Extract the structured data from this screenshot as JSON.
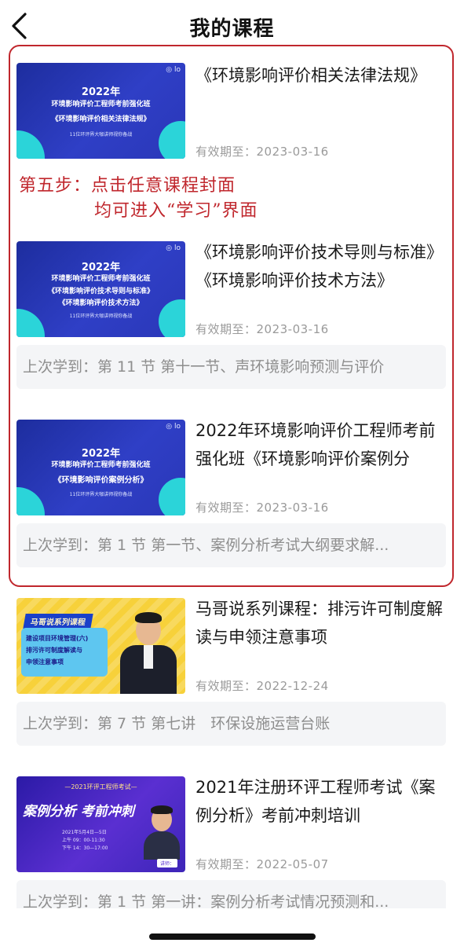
{
  "header": {
    "title": "我的课程"
  },
  "annotation": {
    "line1": "第五步：点击任意课程封面",
    "line2": "均可进入“学习”界面"
  },
  "courses": [
    {
      "title": "《环境影响评价相关法律法规》",
      "expiry": "有效期至：2023-03-16",
      "cover": {
        "year": "2022年",
        "subtitle": "环境影响评价工程师考前强化班",
        "main": "《环境影响评价相关法律法规》",
        "small": "11位环评界大咖讲师视你备战"
      }
    },
    {
      "title": "《环境影响评价技术导则与标准》《环境影响评价技术方法》",
      "expiry": "有效期至：2023-03-16",
      "last_learned": "上次学到：第 11 节  第十一节、声环境影响预测与评价",
      "cover": {
        "year": "2022年",
        "subtitle": "环境影响评价工程师考前强化班",
        "main": "《环境影响评价技术导则与标准》",
        "main2": "《环境影响评价技术方法》",
        "small": "11位环评界大咖讲师视你备战"
      }
    },
    {
      "title": "2022年环境影响评价工程师考前强化班《环境影响评价案例分",
      "expiry": "有效期至：2023-03-16",
      "last_learned": "上次学到：第 1 节  第一节、案例分析考试大纲要求解...",
      "cover": {
        "year": "2022年",
        "subtitle": "环境影响评价工程师考前强化班",
        "main": "《环境影响评价案例分析》",
        "small": "11位环评界大咖讲师视你备战"
      }
    },
    {
      "title": "马哥说系列课程：排污许可制度解读与申领注意事项",
      "expiry": "有效期至：2022-12-24",
      "last_learned": "上次学到：第 7 节  第七讲　环保设施运营台账",
      "cover": {
        "tag": "马哥说系列课程",
        "line1": "建设项目环境管理(六)",
        "line2": "排污许可制度解读与",
        "line3": "申领注意事项"
      }
    },
    {
      "title": "2021年注册环评工程师考试《案例分析》考前冲刺培训",
      "expiry": "有效期至：2022-05-07",
      "last_learned": "上次学到：第 1 节  第一讲：案例分析考试情况预测和...",
      "cover": {
        "top": "—2021环评工程师考试—",
        "main": "案例分析  考前冲刺",
        "date": "2021年5月4日—5日",
        "time1": "上午 09：00-11:30",
        "time2": "下午 14：30—17:00",
        "lecturer": "讲师："
      }
    }
  ],
  "colors": {
    "annotation": "#c0272d",
    "accent_teal": "#2bd4d9",
    "cover_blue": "#2a37b8"
  }
}
